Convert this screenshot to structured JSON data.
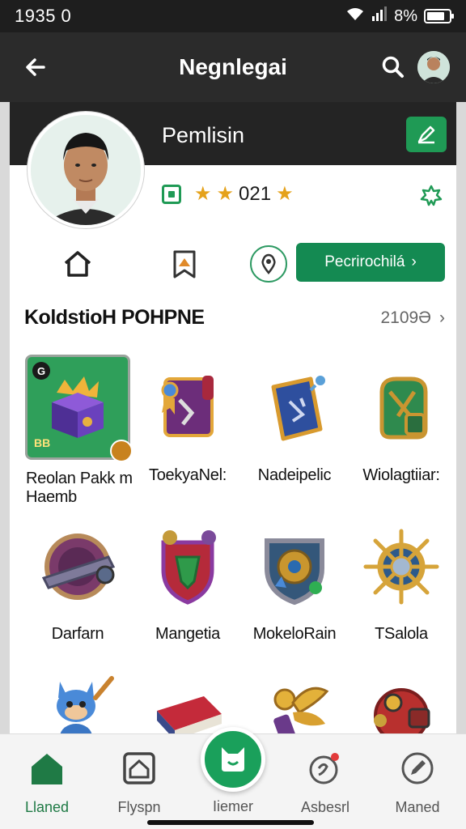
{
  "status_bar": {
    "time": "1935 0",
    "battery": "8%",
    "battery_level": 0.8
  },
  "app_bar": {
    "title": "Negnlegai",
    "back_icon": "back-arrow-icon",
    "search_icon": "search-icon",
    "avatar": "user-avatar"
  },
  "profile": {
    "name": "Pemlisin",
    "rating_value": "021",
    "stars_before": 2,
    "stars_after": 1,
    "edit_icon": "edit-icon"
  },
  "actions": {
    "home_icon": "home-icon",
    "bookmark_icon": "map-bookmark-icon",
    "location_icon": "location-pin-icon",
    "primary_label": "Pecrirochilá",
    "primary_arrow": "›"
  },
  "section": {
    "title": "KoldstioH POHPNE",
    "count": "2109Ə",
    "chevron": "›"
  },
  "items": [
    {
      "label": "Reolan Pakk m Haemb",
      "image": "treasure-chest",
      "selected": true,
      "corner": "G",
      "code": "BB"
    },
    {
      "label": "ToekyaNel:",
      "image": "scroll-banner"
    },
    {
      "label": "Nadeipelic",
      "image": "blue-card-tome"
    },
    {
      "label": "Wiolagtiiar:",
      "image": "green-backpack"
    },
    {
      "label": "Darfarn",
      "image": "purple-shield-ring"
    },
    {
      "label": "Mangetia",
      "image": "red-crest-shield"
    },
    {
      "label": "MokeloRain",
      "image": "blue-gem-shield"
    },
    {
      "label": "TSalola",
      "image": "golden-compass"
    },
    {
      "label": "",
      "image": "blue-fox-creature"
    },
    {
      "label": "",
      "image": "red-book"
    },
    {
      "label": "",
      "image": "golden-wings"
    },
    {
      "label": "",
      "image": "red-mech-orb"
    }
  ],
  "colors": {
    "accent": "#1f9a55",
    "primary_button": "#148a52",
    "dark": "#242424",
    "star": "#e5a21b"
  },
  "bottom_nav": {
    "items": [
      {
        "label": "Llaned",
        "icon": "home-icon",
        "active": true
      },
      {
        "label": "Flyspn",
        "icon": "house-frame-icon"
      },
      {
        "label": "Iiemer",
        "icon": "cat-icon",
        "center": true
      },
      {
        "label": "Asbesrl",
        "icon": "chat-notification-icon"
      },
      {
        "label": "Maned",
        "icon": "compose-icon"
      }
    ]
  }
}
